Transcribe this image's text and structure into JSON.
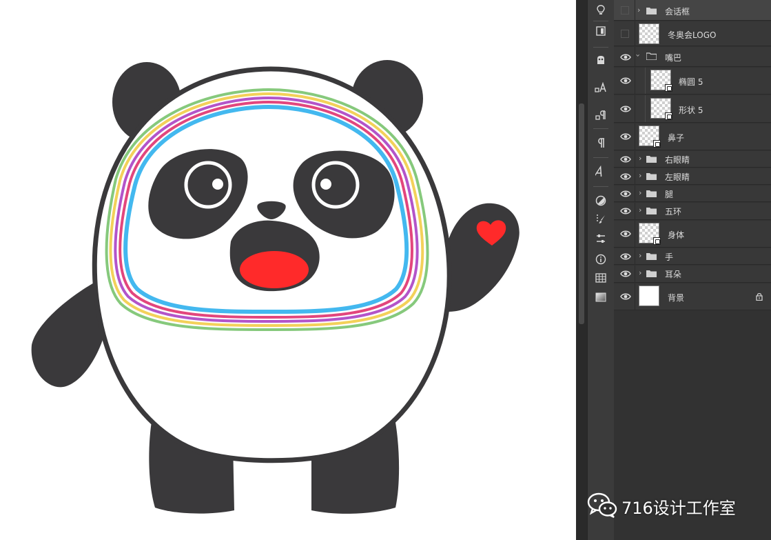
{
  "layers_panel": {
    "layers": [
      {
        "name": "会话框",
        "type": "group",
        "visible": false,
        "expanded": false
      },
      {
        "name": "冬奥会LOGO",
        "type": "layer",
        "visible": false
      },
      {
        "name": "嘴巴",
        "type": "group",
        "visible": true,
        "expanded": true
      },
      {
        "name": "椭圆 5",
        "type": "shape",
        "visible": true,
        "indent": 1
      },
      {
        "name": "形状 5",
        "type": "shape",
        "visible": true,
        "indent": 1
      },
      {
        "name": "鼻子",
        "type": "shape",
        "visible": true
      },
      {
        "name": "右眼睛",
        "type": "group",
        "visible": true,
        "expanded": false
      },
      {
        "name": "左眼睛",
        "type": "group",
        "visible": true,
        "expanded": false
      },
      {
        "name": "腿",
        "type": "group",
        "visible": true,
        "expanded": false
      },
      {
        "name": "五环",
        "type": "group",
        "visible": true,
        "expanded": false
      },
      {
        "name": "身体",
        "type": "shape",
        "visible": true
      },
      {
        "name": "手",
        "type": "group",
        "visible": true,
        "expanded": false
      },
      {
        "name": "耳朵",
        "type": "group",
        "visible": true,
        "expanded": false
      },
      {
        "name": "背景",
        "type": "background",
        "visible": true,
        "locked": true
      }
    ]
  },
  "toolstrip": {
    "icons": [
      "lightbulb-icon",
      "library-icon",
      "properties-icon",
      "character-icon",
      "paragraph-styles-icon",
      "paragraph-icon",
      "glyphs-icon",
      "adjustments-icon",
      "brushes-icon",
      "brush-settings-icon",
      "info-icon",
      "swatches-grid-icon",
      "gradients-icon"
    ]
  },
  "watermark": {
    "text": "716设计工作室",
    "icon": "wechat-icon"
  },
  "colors": {
    "panda_black": "#3a393b",
    "tongue": "#ff2a2a",
    "heart": "#ff2a2a",
    "ring_colors": [
      "#86c97c",
      "#f3d15a",
      "#b354c9",
      "#e2467d",
      "#43b8ef"
    ],
    "panel_bg": "#323232",
    "row_bg": "#383838"
  }
}
